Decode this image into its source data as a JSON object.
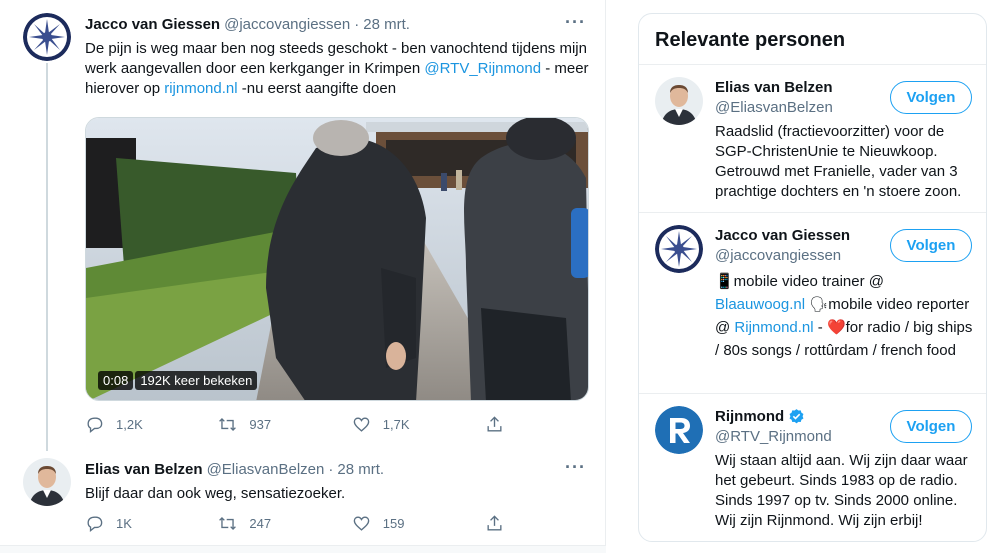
{
  "tweets": [
    {
      "name": "Jacco van Giessen",
      "handle": "@jaccovangiessen",
      "separator": "·",
      "date": "28 mrt.",
      "more": "···",
      "text_parts": [
        "De pijn is weg maar ben nog steeds geschokt - ben vanochtend tijdens mijn werk aangevallen door een kerkganger in Krimpen ",
        "@RTV_Rijnmond",
        " - meer hierover op ",
        "rijnmond.nl",
        " -nu eerst aangifte doen"
      ],
      "video": {
        "duration": "0:08",
        "views": "192K keer bekeken"
      },
      "actions": {
        "replies": "1,2K",
        "retweets": "937",
        "likes": "1,7K"
      }
    },
    {
      "name": "Elias van Belzen",
      "handle": "@EliasvanBelzen",
      "separator": "·",
      "date": "28 mrt.",
      "more": "···",
      "text": "Blijf daar dan ook weg, sensatiezoeker.",
      "actions": {
        "replies": "1K",
        "retweets": "247",
        "likes": "159"
      }
    }
  ],
  "sidebar": {
    "title": "Relevante personen",
    "people": [
      {
        "name": "Elias van Belzen",
        "handle": "@EliasvanBelzen",
        "follow_label": "Volgen",
        "bio": "Raadslid (fractievoorzitter) voor de SGP-ChristenUnie te Nieuwkoop. Getrouwd met Franielle, vader van 3 prachtige dochters en 'n stoere zoon."
      },
      {
        "name": "Jacco van Giessen",
        "handle": "@jaccovangiessen",
        "follow_label": "Volgen",
        "bio_parts": [
          "📱mobile video trainer @ ",
          "Blaauwoog.nl",
          " 🗣mobile video reporter @ ",
          "Rijnmond.nl",
          " - ❤️for radio / big ships / 80s songs / rottûrdam / french food"
        ]
      },
      {
        "name": "Rijnmond",
        "handle": "@RTV_Rijnmond",
        "follow_label": "Volgen",
        "verified": true,
        "bio": "Wij staan altijd aan. Wij zijn daar waar het gebeurt. Sinds 1983 op de radio. Sinds 1997 op tv. Sinds 2000 online. Wij zijn Rijnmond. Wij zijn erbij!"
      }
    ]
  },
  "colors": {
    "link": "#1b95e0",
    "accent": "#1da1f2",
    "muted": "#5b7083"
  },
  "icons": [
    "ellipsis-icon",
    "reply-icon",
    "retweet-icon",
    "like-icon",
    "share-icon",
    "verified-icon"
  ]
}
